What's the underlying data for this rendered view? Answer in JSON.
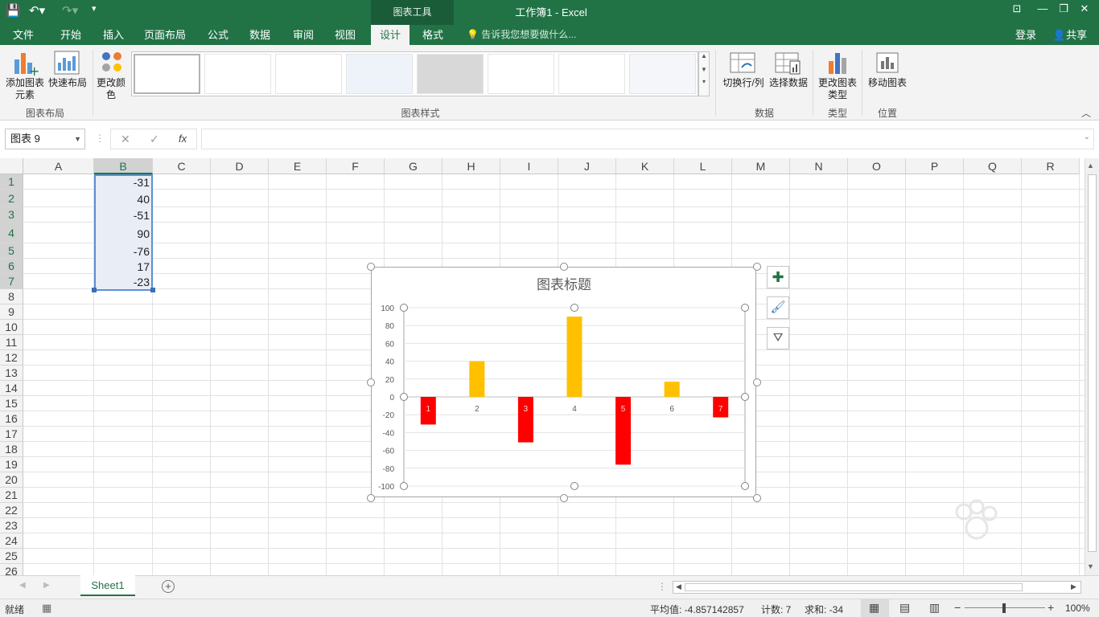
{
  "title_bar": {
    "chart_tools": "图表工具",
    "window_title": "工作簿1 - Excel"
  },
  "tabs": [
    "文件",
    "开始",
    "插入",
    "页面布局",
    "公式",
    "数据",
    "审阅",
    "视图",
    "设计",
    "格式"
  ],
  "active_tab": "设计",
  "tell_me": "告诉我您想要做什么...",
  "account": {
    "login": "登录",
    "share": "共享"
  },
  "ribbon": {
    "add_element": "添加图表元素",
    "quick_layout": "快速布局",
    "change_colors": "更改颜色",
    "group_layout": "图表布局",
    "group_styles": "图表样式",
    "switch_row_col": "切换行/列",
    "select_data": "选择数据",
    "group_data": "数据",
    "change_type": "更改图表类型",
    "group_type": "类型",
    "move_chart": "移动图表",
    "group_location": "位置"
  },
  "formula_bar": {
    "name_box": "图表 9",
    "fx": "fx",
    "formula": ""
  },
  "columns": [
    "A",
    "B",
    "C",
    "D",
    "E",
    "F",
    "G",
    "H",
    "I",
    "J",
    "K",
    "L",
    "M",
    "N",
    "O",
    "P",
    "Q",
    "R"
  ],
  "rows": [
    "1",
    "2",
    "3",
    "4",
    "5",
    "6",
    "7",
    "8",
    "9",
    "10",
    "11",
    "12",
    "13",
    "14",
    "15",
    "16",
    "17",
    "18",
    "19",
    "20",
    "21",
    "22",
    "23",
    "24",
    "25",
    "26"
  ],
  "cells_b": [
    "-31",
    "40",
    "-51",
    "90",
    "-76",
    "17",
    "-23"
  ],
  "chart_data": {
    "type": "bar",
    "title": "图表标题",
    "categories": [
      "1",
      "2",
      "3",
      "4",
      "5",
      "6",
      "7"
    ],
    "values": [
      -31,
      40,
      -51,
      90,
      -76,
      17,
      -23
    ],
    "ylim": [
      -100,
      100
    ],
    "yticks": [
      "100",
      "80",
      "60",
      "40",
      "20",
      "0",
      "-20",
      "-40",
      "-60",
      "-80",
      "-100"
    ],
    "positive_color": "#FFC000",
    "negative_color": "#FF0000",
    "grid": true
  },
  "sheet_tab": "Sheet1",
  "status": {
    "ready": "就绪",
    "average": "平均值: -4.857142857",
    "count": "计数: 7",
    "sum": "求和: -34",
    "zoom": "100%"
  }
}
